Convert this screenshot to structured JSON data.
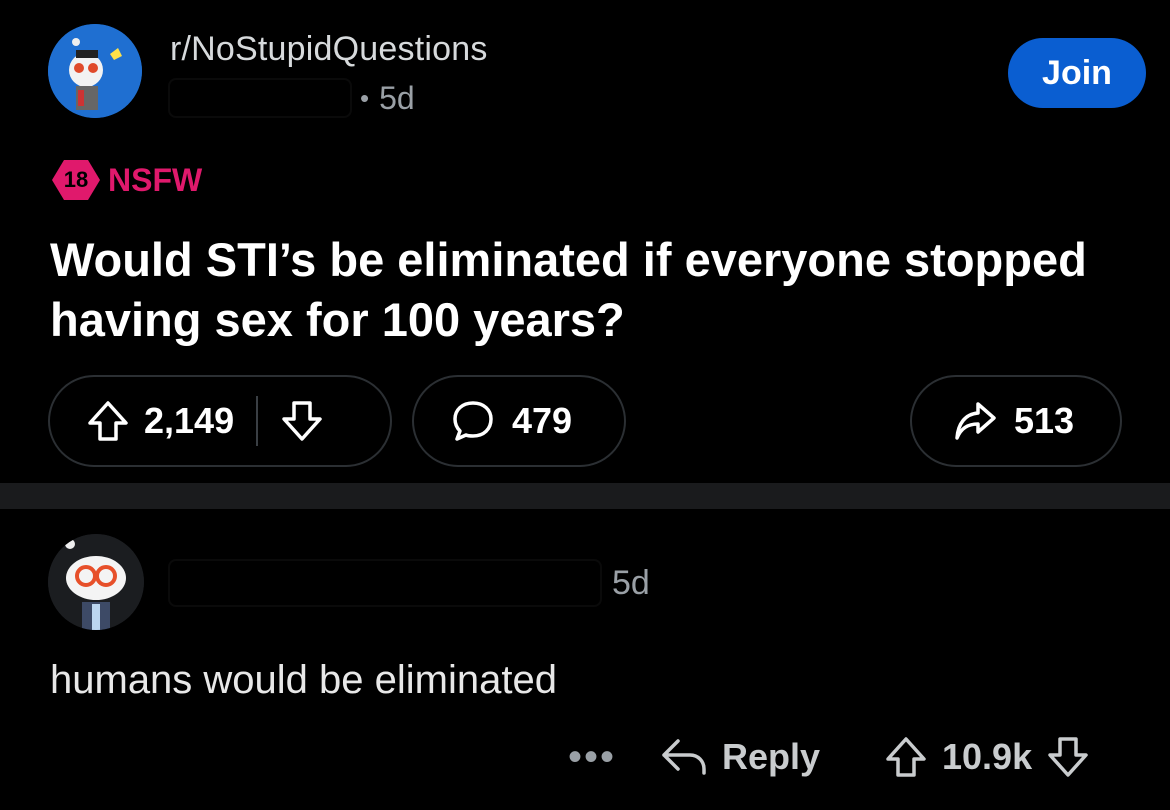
{
  "post": {
    "subreddit": "r/NoStupidQuestions",
    "age": "5d",
    "separator": "•",
    "join_label": "Join",
    "nsfw_badge": "18",
    "nsfw_label": "NSFW",
    "title": "Would STI’s be eliminated if everyone stopped having sex for 100 years?",
    "upvotes": "2,149",
    "comments": "479",
    "shares": "513",
    "icons": [
      "upvote-icon",
      "downvote-icon",
      "comment-icon",
      "share-icon"
    ]
  },
  "comment": {
    "age": "5d",
    "body": "humans would be eliminated",
    "more_label": "•••",
    "reply_label": "Reply",
    "score": "10.9k",
    "icons": [
      "reply-icon",
      "upvote-icon",
      "downvote-icon"
    ]
  },
  "colors": {
    "background": "#000000",
    "join_button": "#0a5ed1",
    "nsfw": "#e0196c",
    "separator": "#1a1b1d"
  }
}
